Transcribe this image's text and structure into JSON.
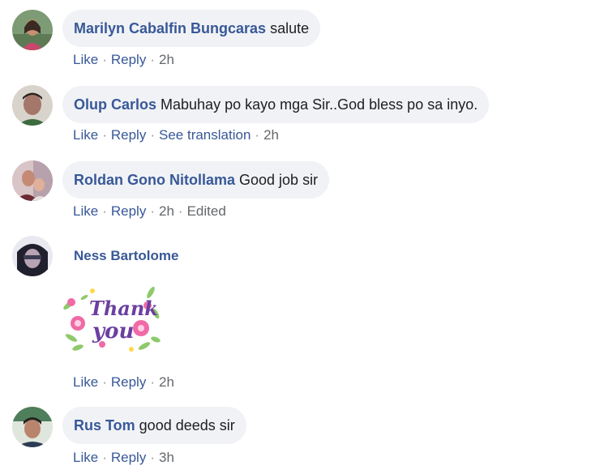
{
  "comments": [
    {
      "author": "Marilyn Cabalfin Bungcaras",
      "text": "salute",
      "actions": {
        "like": "Like",
        "reply": "Reply",
        "time": "2h"
      }
    },
    {
      "author": "Olup Carlos",
      "text": "Mabuhay po kayo mga Sir..God bless po sa inyo.",
      "actions": {
        "like": "Like",
        "reply": "Reply",
        "translate": "See translation",
        "time": "2h"
      }
    },
    {
      "author": "Roldan Gono Nitollama",
      "text": "Good job sir",
      "actions": {
        "like": "Like",
        "reply": "Reply",
        "time": "2h",
        "edited": "Edited"
      }
    },
    {
      "author": "Ness Bartolome",
      "sticker": {
        "icon": "thank-you-flower-sticker-icon",
        "text": "Thank you"
      },
      "actions": {
        "like": "Like",
        "reply": "Reply",
        "time": "2h"
      }
    },
    {
      "author": "Rus Tom",
      "text": "good deeds sir",
      "actions": {
        "like": "Like",
        "reply": "Reply",
        "time": "3h"
      }
    }
  ],
  "separator": "·",
  "colors": {
    "link": "#385898",
    "bubble": "#f0f2f5",
    "meta": "#65676b"
  }
}
